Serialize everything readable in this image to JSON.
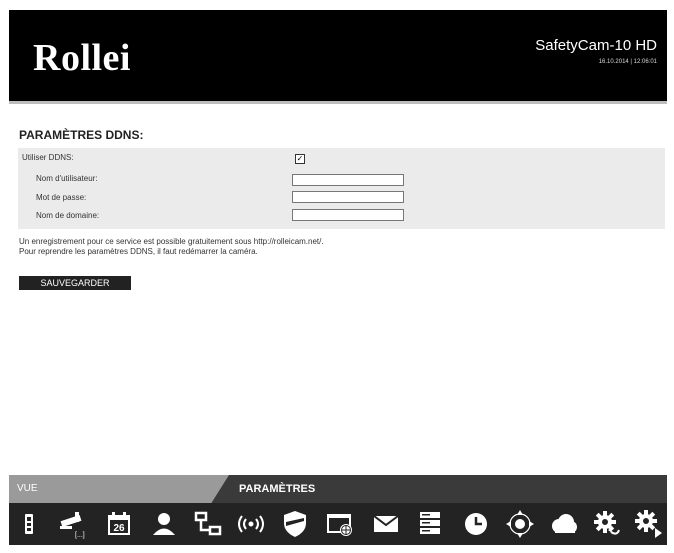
{
  "header": {
    "logo": "Rollei",
    "product": "SafetyCam-10 HD",
    "datetime": "16.10.2014 | 12:06:01"
  },
  "ddns": {
    "title": "PARAMÈTRES DDNS:",
    "use_label": "Utiliser DDNS:",
    "use_checked": "✓",
    "username_label": "Nom d'utilisateur:",
    "password_label": "Mot de passe:",
    "domain_label": "Nom de domaine:",
    "username_value": "",
    "password_value": "",
    "domain_value": "",
    "note_line1": "Un enregistrement pour ce service est possible gratuitement sous http://rolleicam.net/.",
    "note_line2": "Pour reprendre les paramètres DDNS, il faut redémarrer la caméra.",
    "save_label": "SAUVEGARDER"
  },
  "tabs": {
    "view": "VUE",
    "settings": "PARAMÈTRES"
  },
  "toolbar": {
    "icons": [
      "device-info-icon",
      "camera-settings-icon",
      "calendar-icon",
      "user-icon",
      "network-icon",
      "wireless-icon",
      "security-icon",
      "web-browser-icon",
      "mail-icon",
      "storage-icon",
      "time-icon",
      "ptz-icon",
      "cloud-icon",
      "settings-restore-icon",
      "settings-next-icon"
    ],
    "calendar_day": "26",
    "camera_dots": "[...]"
  }
}
